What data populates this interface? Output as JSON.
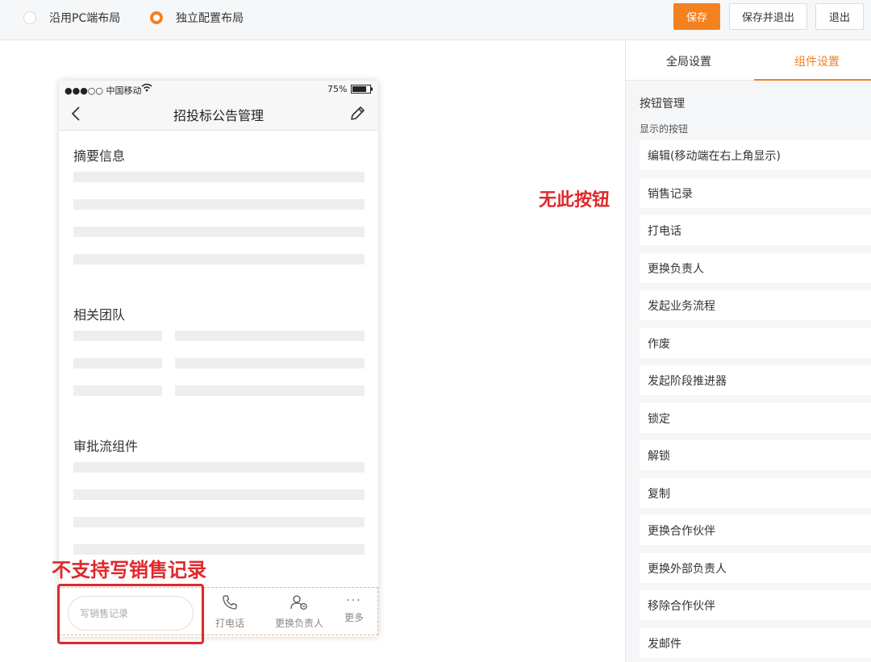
{
  "topbar": {
    "layout_options": [
      {
        "label": "沿用PC端布局",
        "checked": false
      },
      {
        "label": "独立配置布局",
        "checked": true
      }
    ],
    "save_label": "保存",
    "save_exit_label": "保存并退出",
    "exit_label": "退出",
    "accent_color": "#f48120"
  },
  "phone": {
    "status": {
      "carrier": "●●●○○ 中国移动",
      "battery": "75%"
    },
    "title": "招投标公告管理",
    "sections": [
      "摘要信息",
      "相关团队",
      "审批流组件"
    ],
    "bottom": {
      "write_placeholder": "写销售记录",
      "actions": [
        {
          "label": "打电话",
          "icon": "phone-icon"
        },
        {
          "label": "更换负责人",
          "icon": "change-owner-icon"
        },
        {
          "label": "更多",
          "icon": "more-icon"
        }
      ]
    }
  },
  "annotations": {
    "no_button": "无此按钮",
    "not_supported": "不支持写销售记录",
    "color": "#e0282a"
  },
  "panel": {
    "tabs": [
      {
        "label": "全局设置",
        "active": false
      },
      {
        "label": "组件设置",
        "active": true
      }
    ],
    "heading": "按钮管理",
    "subheading": "显示的按钮",
    "buttons": [
      "编辑(移动端在右上角显示)",
      "销售记录",
      "打电话",
      "更换负责人",
      "发起业务流程",
      "作废",
      "发起阶段推进器",
      "锁定",
      "解锁",
      "复制",
      "更换合作伙伴",
      "更换外部负责人",
      "移除合作伙伴",
      "发邮件"
    ]
  }
}
